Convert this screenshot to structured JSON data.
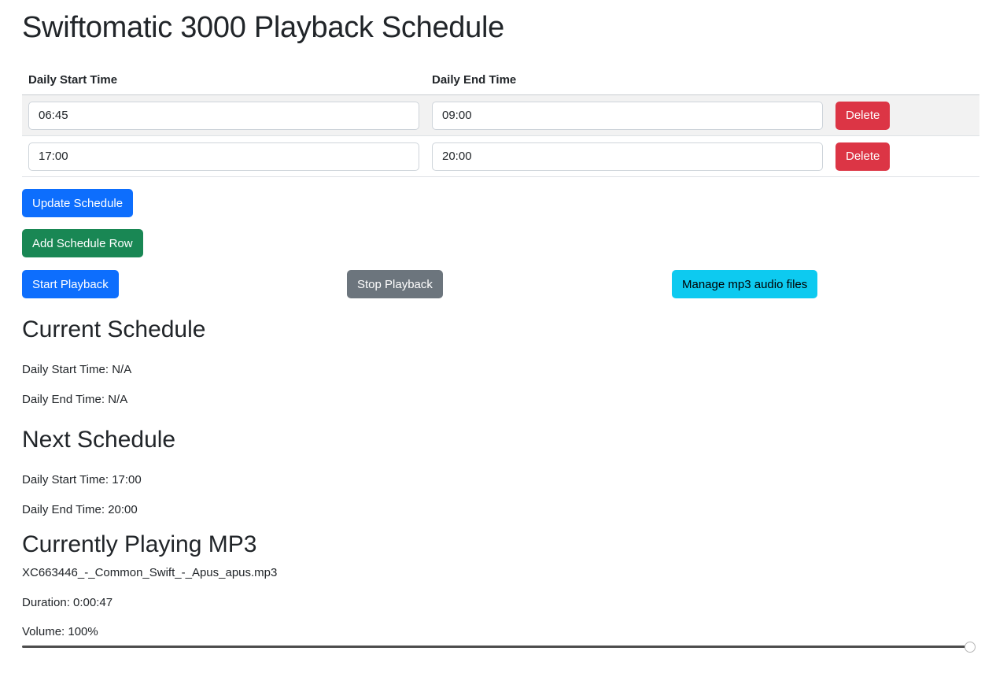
{
  "header": {
    "title": "Swiftomatic 3000 Playback Schedule"
  },
  "schedule_table": {
    "headers": {
      "start": "Daily Start Time",
      "end": "Daily End Time"
    },
    "rows": [
      {
        "start": "06:45",
        "end": "09:00",
        "delete_label": "Delete"
      },
      {
        "start": "17:00",
        "end": "20:00",
        "delete_label": "Delete"
      }
    ]
  },
  "buttons": {
    "update": "Update Schedule",
    "add_row": "Add Schedule Row",
    "start_playback": "Start Playback",
    "stop_playback": "Stop Playback",
    "manage_files": "Manage mp3 audio files"
  },
  "current_schedule": {
    "title": "Current Schedule",
    "start_text": "Daily Start Time: N/A",
    "end_text": "Daily End Time: N/A"
  },
  "next_schedule": {
    "title": "Next Schedule",
    "start_text": "Daily Start Time: 17:00",
    "end_text": "Daily End Time: 20:00"
  },
  "currently_playing": {
    "title": "Currently Playing MP3",
    "filename": "XC663446_-_Common_Swift_-_Apus_apus.mp3",
    "duration_text": "Duration: 0:00:47",
    "volume_text": "Volume: 100%",
    "volume_value": 100
  },
  "colors": {
    "primary": "#0d6efd",
    "success": "#198754",
    "danger": "#dc3545",
    "secondary": "#6c757d",
    "info": "#0dcaf0"
  }
}
